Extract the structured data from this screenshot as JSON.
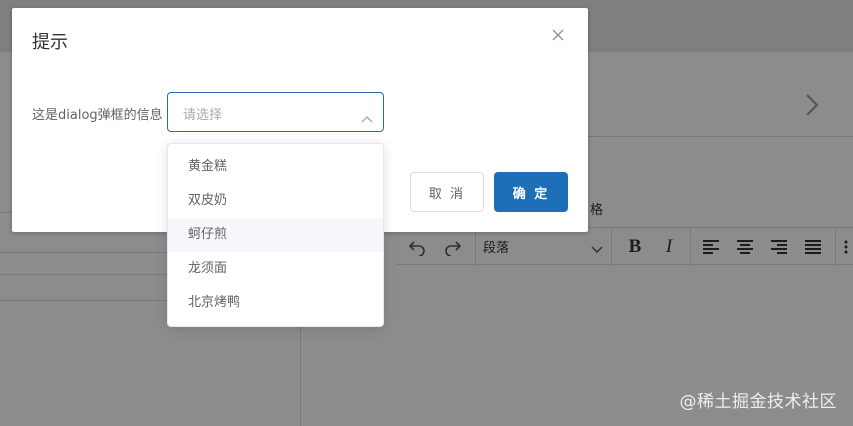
{
  "dialog": {
    "title": "提示",
    "body_text": "这是dialog弹框的信息",
    "cancel_label": "取 消",
    "confirm_label": "确 定"
  },
  "select": {
    "placeholder": "请选择",
    "options": [
      "黄金糕",
      "双皮奶",
      "蚵仔煎",
      "龙须面",
      "北京烤鸭"
    ],
    "hovered_option": "蚵仔煎"
  },
  "background": {
    "text_fragment": "格",
    "toolbar": {
      "block_format": "段落",
      "bold": "B",
      "italic": "I"
    }
  },
  "watermark": "@稀土掘金技术社区",
  "icons": {
    "close": "close-icon",
    "select_arrow": "chevron-up-icon",
    "nav_next": "chevron-right-icon",
    "undo": "undo-icon",
    "redo": "redo-icon",
    "align_left": "align-left-icon",
    "align_center": "align-center-icon",
    "align_right": "align-right-icon",
    "align_justify": "align-justify-icon"
  },
  "colors": {
    "primary": "#1d6fb8",
    "select_border": "#2d6ba6",
    "hover_bg": "#f5f7fa"
  }
}
